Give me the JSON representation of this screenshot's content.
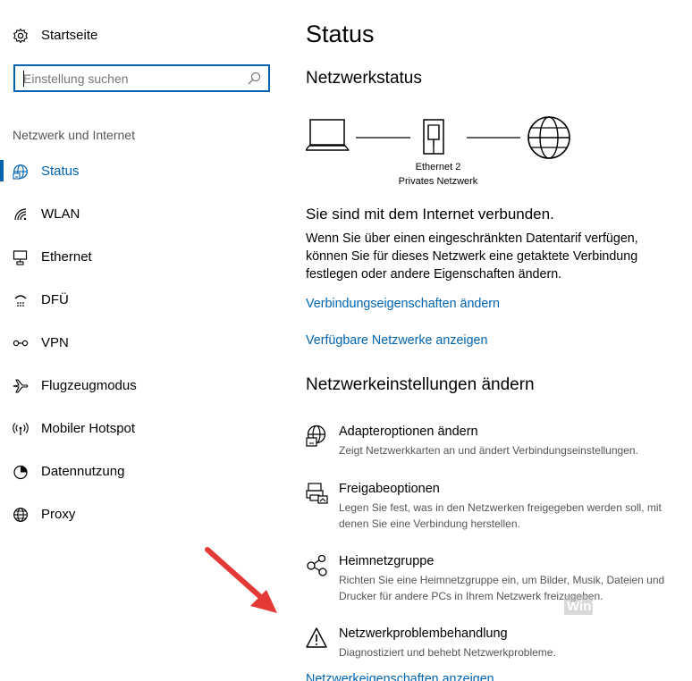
{
  "sidebar": {
    "home_label": "Startseite",
    "search_placeholder": "Einstellung suchen",
    "section_header": "Netzwerk und Internet",
    "items": [
      {
        "label": "Status",
        "icon": "globe-status-icon"
      },
      {
        "label": "WLAN",
        "icon": "wifi-icon"
      },
      {
        "label": "Ethernet",
        "icon": "ethernet-icon"
      },
      {
        "label": "DFÜ",
        "icon": "dialup-icon"
      },
      {
        "label": "VPN",
        "icon": "vpn-icon"
      },
      {
        "label": "Flugzeugmodus",
        "icon": "airplane-icon"
      },
      {
        "label": "Mobiler Hotspot",
        "icon": "hotspot-icon"
      },
      {
        "label": "Datennutzung",
        "icon": "data-usage-icon"
      },
      {
        "label": "Proxy",
        "icon": "globe-icon"
      }
    ],
    "active_index": 0
  },
  "main": {
    "title": "Status",
    "network_status_heading": "Netzwerkstatus",
    "diagram": {
      "adapter_name": "Ethernet 2",
      "network_type": "Privates Netzwerk"
    },
    "connected_text": "Sie sind mit dem Internet verbunden.",
    "info_text": "Wenn Sie über einen eingeschränkten Datentarif verfügen, können Sie für dieses Netzwerk eine getaktete Verbindung festlegen oder andere Eigenschaften ändern.",
    "link_properties": "Verbindungseigenschaften ändern",
    "link_networks": "Verfügbare Netzwerke anzeigen",
    "change_heading": "Netzwerkeinstellungen ändern",
    "options": [
      {
        "title": "Adapteroptionen ändern",
        "desc": "Zeigt Netzwerkkarten an und ändert Verbindungseinstellungen.",
        "icon": "adapter-icon"
      },
      {
        "title": "Freigabeoptionen",
        "desc": "Legen Sie fest, was in den Netzwerken freigegeben werden soll, mit denen Sie eine Verbindung herstellen.",
        "icon": "sharing-icon"
      },
      {
        "title": "Heimnetzgruppe",
        "desc": "Richten Sie eine Heimnetzgruppe ein, um Bilder, Musik, Dateien und Drucker für andere PCs in Ihrem Netzwerk freizugeben.",
        "icon": "homegroup-icon"
      },
      {
        "title": "Netzwerkproblembehandlung",
        "desc": "Diagnostiziert und behebt Netzwerkprobleme.",
        "icon": "warning-icon"
      }
    ],
    "link_bottom": "Netzwerkeigenschaften anzeigen"
  },
  "colors": {
    "accent": "#0063b1",
    "annotation_arrow": "#e53935"
  },
  "watermark": "WinTotal"
}
